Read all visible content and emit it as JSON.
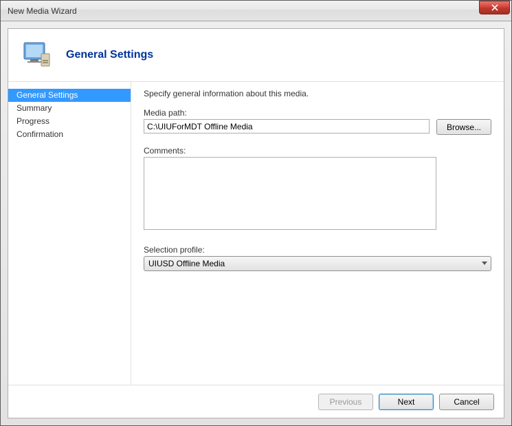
{
  "window": {
    "title": "New Media Wizard"
  },
  "header": {
    "title": "General Settings"
  },
  "sidebar": {
    "items": [
      {
        "label": "General Settings",
        "active": true
      },
      {
        "label": "Summary",
        "active": false
      },
      {
        "label": "Progress",
        "active": false
      },
      {
        "label": "Confirmation",
        "active": false
      }
    ]
  },
  "main": {
    "instruction": "Specify general information about this media.",
    "media_path_label": "Media path:",
    "media_path_value": "C:\\UIUForMDT Offline Media",
    "browse_label": "Browse...",
    "comments_label": "Comments:",
    "comments_value": "",
    "selection_profile_label": "Selection profile:",
    "selection_profile_value": "UIUSD Offline Media"
  },
  "footer": {
    "previous": "Previous",
    "next": "Next",
    "cancel": "Cancel"
  }
}
